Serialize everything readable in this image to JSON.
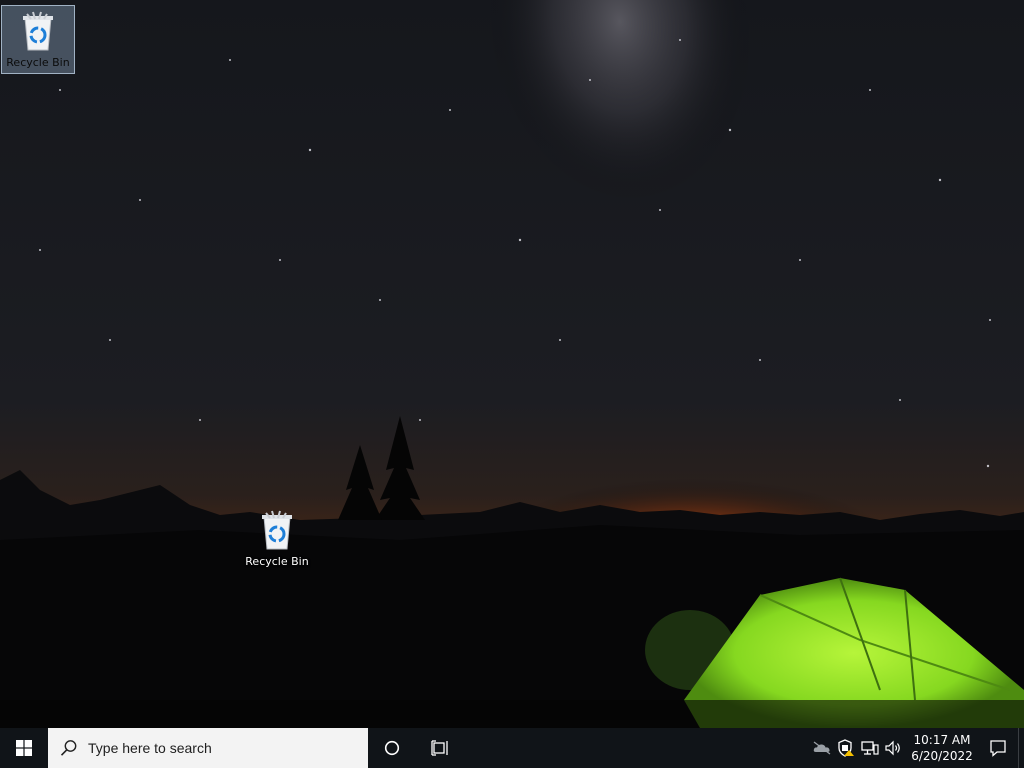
{
  "desktop": {
    "icons": [
      {
        "label": "Recycle Bin",
        "icon": "recycle-bin-icon",
        "selected": true
      },
      {
        "label": "Recycle Bin",
        "icon": "recycle-bin-icon",
        "selected": false
      }
    ]
  },
  "taskbar": {
    "start_icon": "windows-logo-icon",
    "search": {
      "placeholder": "Type here to search",
      "icon": "search-icon"
    },
    "cortana_icon": "cortana-circle-icon",
    "taskview_icon": "task-view-icon",
    "tray": {
      "icons": [
        "onedrive-icon",
        "security-warning-icon",
        "network-icon",
        "volume-icon"
      ],
      "time": "10:17 AM",
      "date": "6/20/2022",
      "notification_icon": "action-center-icon"
    }
  },
  "colors": {
    "taskbar": "#101418",
    "search_bg": "#f3f3f3",
    "tent_green": "#8fe82a",
    "horizon_orange": "#ff7a1a"
  }
}
